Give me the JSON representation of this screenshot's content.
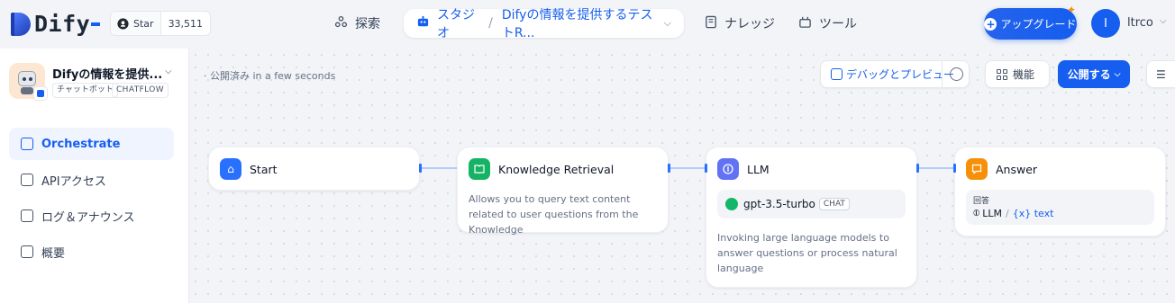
{
  "brand": {
    "name": "Dify"
  },
  "github": {
    "star_label": "Star",
    "star_count": "33,511"
  },
  "nav": {
    "explore": "探索",
    "studio": "スタジオ",
    "studio_app": "Difyの情報を提供するテストR...",
    "knowledge": "ナレッジ",
    "tools": "ツール"
  },
  "account": {
    "upgrade": "アップグレード",
    "avatar_initial": "I",
    "username": "ltrco"
  },
  "app": {
    "name": "Difyの情報を提供...",
    "type_tag": "チャットボット",
    "mode_tag": "CHATFLOW"
  },
  "sidebar": {
    "items": [
      {
        "label": "Orchestrate"
      },
      {
        "label": "APIアクセス"
      },
      {
        "label": "ログ＆アナウンス"
      },
      {
        "label": "概要"
      }
    ]
  },
  "toolbar": {
    "status": "· 公開済み in a few seconds",
    "debug": "デバッグとプレビュー",
    "features": "機能",
    "publish": "公開する"
  },
  "nodes": {
    "start": {
      "title": "Start"
    },
    "knowledge": {
      "title": "Knowledge Retrieval",
      "desc": "Allows you to query text content related to user questions from the Knowledge"
    },
    "llm": {
      "title": "LLM",
      "model": "gpt-3.5-turbo",
      "model_tag": "CHAT",
      "desc": "Invoking large language models to answer questions or process natural language"
    },
    "answer": {
      "title": "Answer",
      "label": "回答",
      "source": "LLM",
      "var": "{x} text"
    }
  },
  "colors": {
    "accent": "#155eef",
    "start": "#2970ff",
    "knowledge": "#16b364",
    "llm": "#6172f3",
    "answer": "#f79009"
  }
}
